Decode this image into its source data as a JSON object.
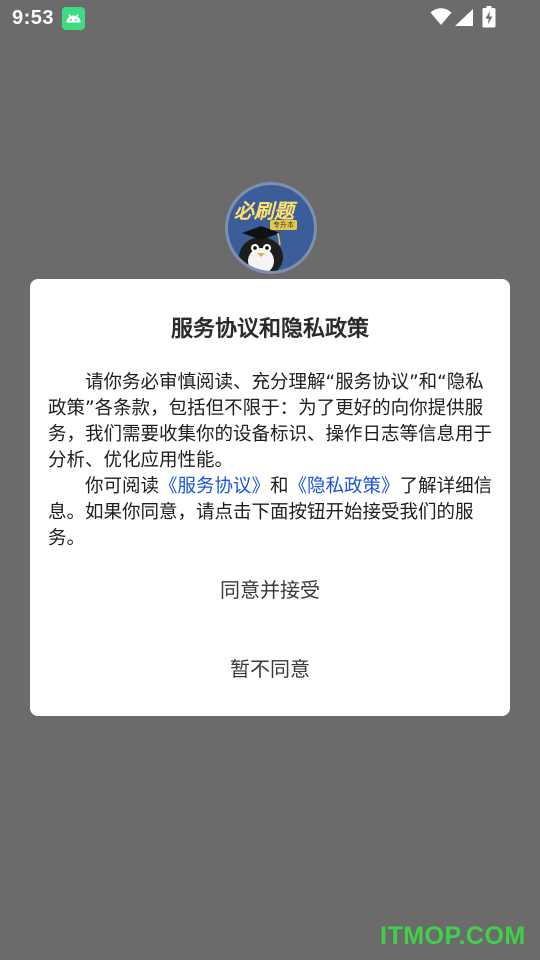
{
  "status_bar": {
    "time": "9:53",
    "icons": [
      "android-notification-icon",
      "wifi-icon",
      "signal-icon",
      "battery-charging-icon"
    ]
  },
  "logo": {
    "text": "必刷题",
    "sub_text": "专升本"
  },
  "dialog": {
    "title": "服务协议和隐私政策",
    "paragraph1": "请你务必审慎阅读、充分理解“服务协议”和“隐私政策”各条款，包括但不限于：为了更好的向你提供服务，我们需要收集你的设备标识、操作日志等信息用于分析、优化应用性能。",
    "paragraph2_prefix": "你可阅读",
    "service_link": "《服务协议》",
    "conjunction": "和",
    "privacy_link": "《隐私政策》",
    "paragraph2_suffix": "了解详细信息。如果你同意，请点击下面按钮开始接受我们的服务。",
    "accept_label": "同意并接受",
    "decline_label": "暂不同意"
  },
  "watermark": "ITMOP.COM",
  "colors": {
    "overlay": "#6b6b6b",
    "link": "#1a56d8",
    "watermark": "#3fd14a"
  }
}
